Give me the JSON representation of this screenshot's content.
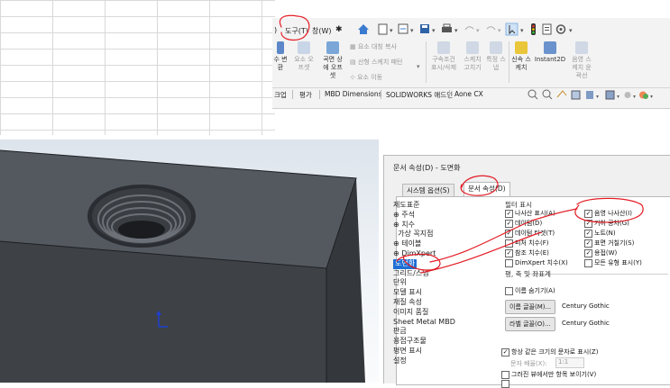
{
  "ribbon": {
    "menus": [
      "도구(T)",
      "창(W)"
    ],
    "menu_prefix": ")",
    "row1_buttons": [
      {
        "label": "수 변\n환",
        "gray": false
      },
      {
        "label": "요소 오\n프셋",
        "gray": true
      },
      {
        "label": "곡면 상\n에 오프\n셋",
        "gray": false
      }
    ],
    "small_items": [
      "요소 대칭 복사",
      "선형 스케치 패턴",
      "요소 이동"
    ],
    "row1_right": [
      {
        "label": "구속조건\n표시/삭제",
        "gray": true
      },
      {
        "label": "스케치\n고치기",
        "gray": true
      },
      {
        "label": "특정 스\n냅",
        "gray": true
      },
      {
        "label": "신속 스\n케치",
        "gray": false
      },
      {
        "label": "Instant2D",
        "gray": false
      },
      {
        "label": "음영 스\n케치 윤\n곽선",
        "gray": true
      }
    ],
    "tabs": [
      "크업",
      "평가",
      "MBD Dimensions",
      "SOLIDWORKS 애드인",
      "Aone CX"
    ]
  },
  "dialog": {
    "title": "문서 속성(D) - 도면화",
    "tabs": [
      "시스템 옵션(S)",
      "문서 속성(D)"
    ],
    "tree": [
      "제도표준",
      "⊕ 주석",
      "⊕ 치수",
      "  가상 꼭지점",
      "⊕ 테이블",
      "⊕ DimXpert",
      "도면화",
      "그리드/스냅",
      "단위",
      "모델 표시",
      "재질 속성",
      "이미지 품질",
      "Sheet Metal MBD",
      "판금",
      "용접구조물",
      "평면 표시",
      "설정"
    ],
    "selected_tree_item": "도면화",
    "filter_section": "필터 표시",
    "filters_left": [
      {
        "label": "나사산 표시(A)",
        "checked": true
      },
      {
        "label": "데이텀(D)",
        "checked": true
      },
      {
        "label": "데이텀 타겟(T)",
        "checked": true
      },
      {
        "label": "피처 치수(F)",
        "checked": false
      },
      {
        "label": "참조 치수(E)",
        "checked": true
      },
      {
        "label": "DimXpert 치수(X)",
        "checked": false
      }
    ],
    "filters_right": [
      {
        "label": "음영 나사산(I)",
        "checked": true
      },
      {
        "label": "기하 공차(G)",
        "checked": true
      },
      {
        "label": "노트(N)",
        "checked": true
      },
      {
        "label": "표면 거칠기(S)",
        "checked": true
      },
      {
        "label": "용접(W)",
        "checked": true
      },
      {
        "label": "모든 유형 표시(Y)",
        "checked": false
      }
    ],
    "plane_section": "평, 축 및 좌표계",
    "hide_names": "이름 숨기기(A)",
    "name_font_btn": "이름 글꼴(M)...",
    "name_font": "Century Gothic",
    "label_font_btn": "라벨 글꼴(O)...",
    "label_font": "Century Gothic",
    "same_size": "항상 같은 크기의 문자로 표시(Z)",
    "text_scale_label": "문자 배율(X):",
    "text_scale": "1:1",
    "only_view": "그러진 뷰에서만 항목 보이기(V)"
  },
  "colors": {
    "accent": "#1e6fd4",
    "annotation": "#e31b23",
    "part": "#4b4f56"
  }
}
